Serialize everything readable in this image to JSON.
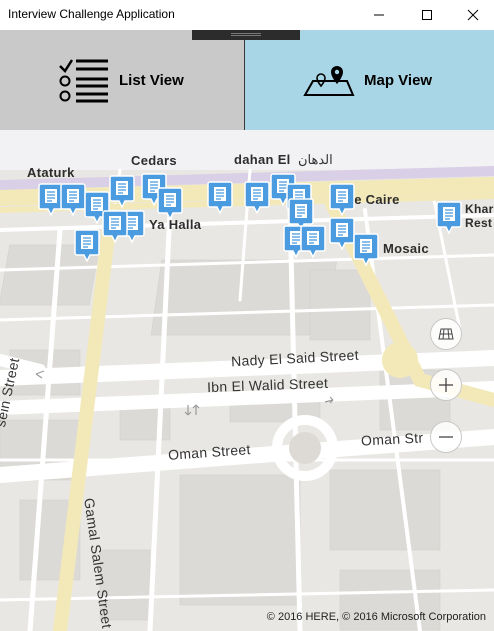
{
  "window": {
    "title": "Interview Challenge Application",
    "minimize_icon": "minimize-icon",
    "maximize_icon": "maximize-icon",
    "close_icon": "close-icon"
  },
  "tabs": {
    "list": {
      "label": "List View",
      "icon": "checklist-icon"
    },
    "map": {
      "label": "Map View",
      "icon": "map-pins-icon"
    },
    "active": "map",
    "colors": {
      "list_bg": "#c9c9c9",
      "map_bg": "#a8d6e6"
    }
  },
  "map": {
    "labels": {
      "ataturk": "Ataturk",
      "cedars": "Cedars",
      "dahan_en": "dahan El",
      "dahan_ar": "الدهان",
      "ya_halla": "Ya Halla",
      "le_caire": "Le Caire",
      "mosaic": "Mosaic",
      "khan_1": "Khar",
      "khan_2": "Rest",
      "nady": "Nady El Said Street",
      "ibn": "Ibn El Walid Street",
      "oman_1": "Oman Street",
      "oman_2": "Oman Str",
      "gamal": "Gamal Salem Street",
      "hussein": "sein Street"
    },
    "controls": {
      "view_icon": "map-style-icon",
      "zoom_in_icon": "zoom-in-icon",
      "zoom_out_icon": "zoom-out-icon"
    },
    "copyright": "© 2016 HERE, © 2016 Microsoft Corporation",
    "pin_color": "#4a9be0"
  }
}
